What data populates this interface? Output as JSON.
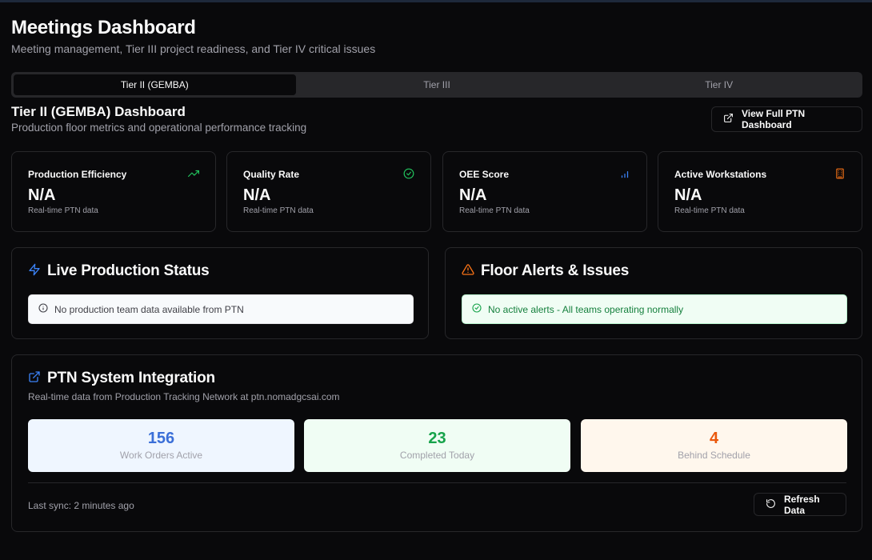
{
  "page": {
    "title": "Meetings Dashboard",
    "subtitle": "Meeting management, Tier III project readiness, and Tier IV critical issues"
  },
  "tabs": [
    {
      "label": "Tier II (GEMBA)",
      "active": true
    },
    {
      "label": "Tier III",
      "active": false
    },
    {
      "label": "Tier IV",
      "active": false
    }
  ],
  "section": {
    "title": "Tier II (GEMBA) Dashboard",
    "subtitle": "Production floor metrics and operational performance tracking",
    "ptn_button_label": "View Full PTN Dashboard",
    "ptn_button_icon": "external-link-icon"
  },
  "metrics": [
    {
      "label": "Production Efficiency",
      "value": "N/A",
      "note": "Real-time PTN data",
      "icon": "trending-up-icon",
      "icon_color": "#22c55e"
    },
    {
      "label": "Quality Rate",
      "value": "N/A",
      "note": "Real-time PTN data",
      "icon": "check-circle-icon",
      "icon_color": "#22c55e"
    },
    {
      "label": "OEE Score",
      "value": "N/A",
      "note": "Real-time PTN data",
      "icon": "bar-chart-icon",
      "icon_color": "#3b82f6"
    },
    {
      "label": "Active Workstations",
      "value": "N/A",
      "note": "Real-time PTN data",
      "icon": "building-icon",
      "icon_color": "#f97316"
    }
  ],
  "live_status": {
    "title": "Live Production Status",
    "icon": "zap-icon",
    "icon_color": "#3b82f6",
    "message": "No production team data available from PTN",
    "message_icon": "info-circle-icon"
  },
  "floor_alerts": {
    "title": "Floor Alerts & Issues",
    "icon": "alert-triangle-icon",
    "icon_color": "#f97316",
    "message": "No active alerts - All teams operating normally",
    "message_icon": "check-circle-icon"
  },
  "ptn": {
    "title": "PTN System Integration",
    "icon": "external-link-icon",
    "icon_color": "#3b82f6",
    "subtitle": "Real-time data from Production Tracking Network at ptn.nomadgcsai.com",
    "stats": [
      {
        "value": "156",
        "label": "Work Orders Active",
        "color": "#3b6fd8"
      },
      {
        "value": "23",
        "label": "Completed Today",
        "color": "#16a34a"
      },
      {
        "value": "4",
        "label": "Behind Schedule",
        "color": "#ea580c"
      }
    ],
    "last_sync": "Last sync: 2 minutes ago",
    "refresh_label": "Refresh Data",
    "refresh_icon": "refresh-icon"
  },
  "colors": {
    "background": "#09090b",
    "border": "#27272a",
    "muted_text": "#a1a1aa"
  }
}
